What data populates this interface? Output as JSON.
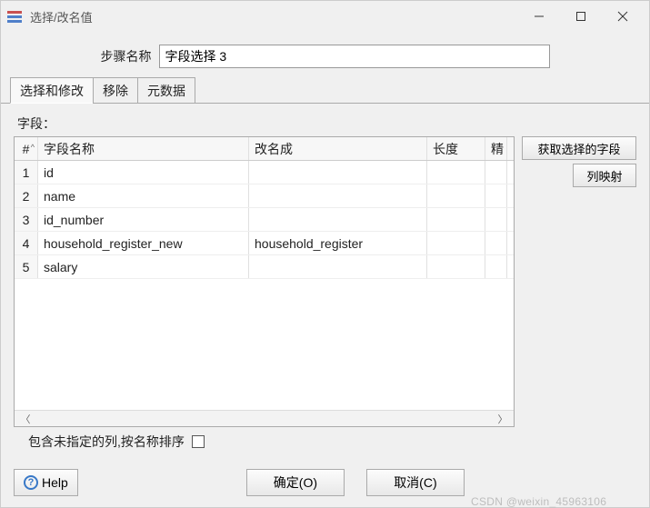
{
  "title": "选择/改名值",
  "step": {
    "label": "步骤名称",
    "value": "字段选择 3"
  },
  "tabs": [
    "选择和修改",
    "移除",
    "元数据"
  ],
  "activeTab": 0,
  "fieldsLabel": "字段：",
  "columns": {
    "num": "#",
    "name": "字段名称",
    "rename": "改名成",
    "len": "长度",
    "prec": "精"
  },
  "rows": [
    {
      "n": "1",
      "name": "id",
      "rename": "",
      "len": "",
      "prec": ""
    },
    {
      "n": "2",
      "name": "name",
      "rename": "",
      "len": "",
      "prec": ""
    },
    {
      "n": "3",
      "name": "id_number",
      "rename": "",
      "len": "",
      "prec": ""
    },
    {
      "n": "4",
      "name": "household_register_new",
      "rename": "household_register",
      "len": "",
      "prec": ""
    },
    {
      "n": "5",
      "name": "salary",
      "rename": "",
      "len": "",
      "prec": ""
    }
  ],
  "sideButtons": {
    "getFields": "获取选择的字段",
    "colMapping": "列映射"
  },
  "checkbox": {
    "label": "包含未指定的列,按名称排序"
  },
  "footer": {
    "help": "Help",
    "ok": "确定(O)",
    "cancel": "取消(C)"
  },
  "watermark": "CSDN @weixin_45963106"
}
